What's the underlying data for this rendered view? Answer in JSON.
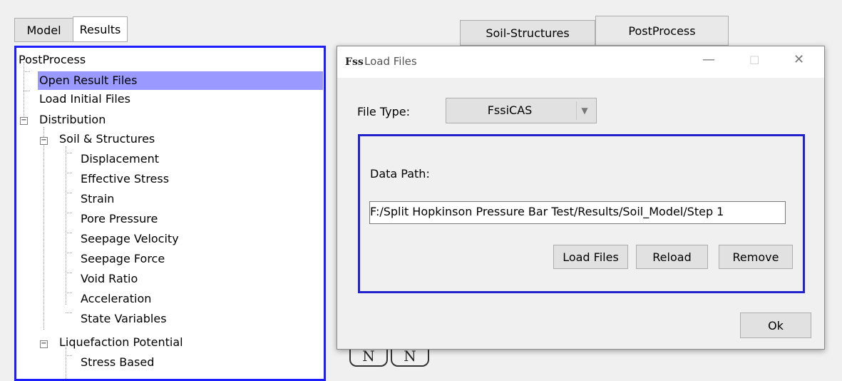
{
  "left_tabs": {
    "model": "Model",
    "results": "Results"
  },
  "right_tabs": {
    "soil_structures": "Soil-Structures",
    "post_process": "PostProcess"
  },
  "tree": {
    "root": "PostProcess",
    "open_result_files": "Open Result Files",
    "load_initial_files": "Load Initial Files",
    "distribution": "Distribution",
    "soil_structures": "Soil & Structures",
    "leaves": [
      "Displacement",
      "Effective Stress",
      "Strain",
      "Pore Pressure",
      "Seepage Velocity",
      "Seepage Force",
      "Void Ratio",
      "Acceleration",
      "State Variables"
    ],
    "liquefaction": "Liquefaction Potential",
    "stress_based": "Stress Based",
    "selected": "Open Result Files"
  },
  "dialog": {
    "icon_text": "Fss",
    "title": "Load Files",
    "minimize": "—",
    "maximize": "☐",
    "close": "✕",
    "file_type_label": "File Type:",
    "file_type_value": "FssiCAS",
    "data_path_label": "Data Path:",
    "data_path_value": "F:/Split Hopkinson Pressure Bar Test/Results/Soil_Model/Step 1",
    "load_files": "Load Files",
    "reload": "Reload",
    "remove": "Remove",
    "ok": "Ok"
  },
  "colors": {
    "selection": "#9999ff",
    "panel_border": "#1d1dff",
    "group_border": "#2222cc"
  }
}
